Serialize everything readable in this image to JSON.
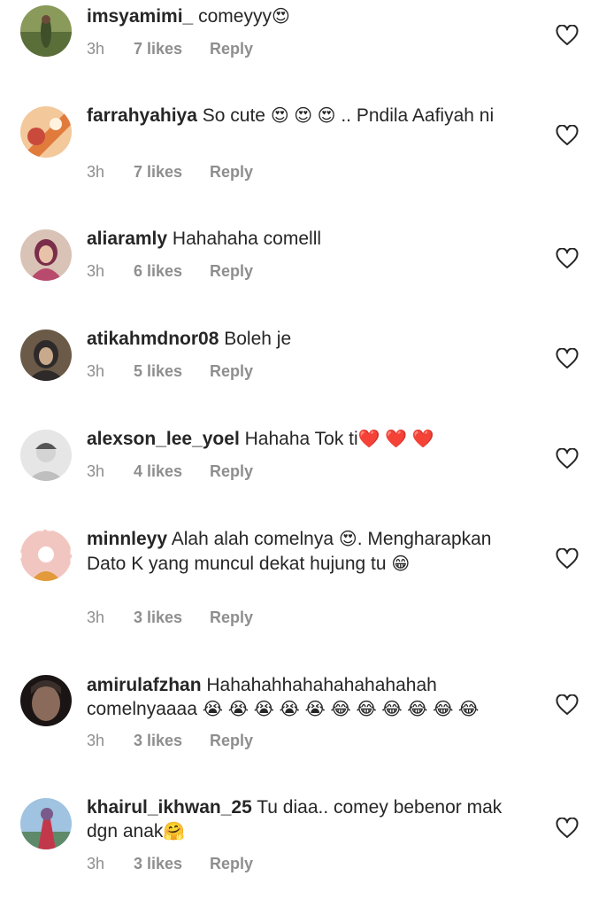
{
  "comments": [
    {
      "username": "imsyamimi_",
      "text": "comeyyy",
      "emojis": "😍",
      "time": "3h",
      "likes": "7 likes",
      "reply": "Reply",
      "avatar_colors": [
        "#5a6e3a",
        "#8a9a5b",
        "#3f4f2a"
      ]
    },
    {
      "username": "farrahyahiya",
      "text": "So cute",
      "emojis": "😍 😍 😍",
      "text_after": ".. Pndila Aafiyah ni",
      "time": "3h",
      "likes": "7 likes",
      "reply": "Reply",
      "avatar_colors": [
        "#f3c89b",
        "#e07b3c",
        "#c94a3a"
      ]
    },
    {
      "username": "aliaramly",
      "text": "Hahahaha comelll",
      "time": "3h",
      "likes": "6 likes",
      "reply": "Reply",
      "avatar_colors": [
        "#d9c2b6",
        "#b84a6e",
        "#7a2e4a"
      ]
    },
    {
      "username": "atikahmdnor08",
      "text": "Boleh je",
      "time": "3h",
      "likes": "5 likes",
      "reply": "Reply",
      "avatar_colors": [
        "#6b5a48",
        "#2e2a2a",
        "#c9a98b"
      ]
    },
    {
      "username": "alexson_lee_yoel",
      "text": "Hahaha Tok ti",
      "emojis": "❤️ ❤️ ❤️",
      "time": "3h",
      "likes": "4 likes",
      "reply": "Reply",
      "avatar_colors": [
        "#e6e6e6",
        "#bfbfbf",
        "#555555"
      ]
    },
    {
      "username": "minnleyy",
      "text": "Alah alah comelnya",
      "emojis": "😍",
      "text_after": ". Mengharapkan Dato K yang muncul dekat hujung tu",
      "emojis_after": "😁",
      "time": "3h",
      "likes": "3 likes",
      "reply": "Reply",
      "avatar_colors": [
        "#f2c6c0",
        "#e39a3a",
        "#ffffff"
      ]
    },
    {
      "username": "amirulafzhan",
      "text": "Hahahahhahahahahahahah comelnyaaaa",
      "emojis": "😭 😭 😭 😭 😭 😂 😂 😂 😂 😂 😂",
      "time": "3h",
      "likes": "3 likes",
      "reply": "Reply",
      "avatar_colors": [
        "#3a2f2a",
        "#8a6a5a",
        "#1a1414"
      ]
    },
    {
      "username": "khairul_ikhwan_25",
      "text": "Tu diaa.. comey bebenor mak dgn anak",
      "emojis": "🤗",
      "time": "3h",
      "likes": "3 likes",
      "reply": "Reply",
      "avatar_colors": [
        "#9fc3e0",
        "#7a5a8a",
        "#c2384a"
      ]
    }
  ],
  "colors": {
    "text": "#262626",
    "muted": "#8e8e8e",
    "heart_stroke": "#262626"
  }
}
